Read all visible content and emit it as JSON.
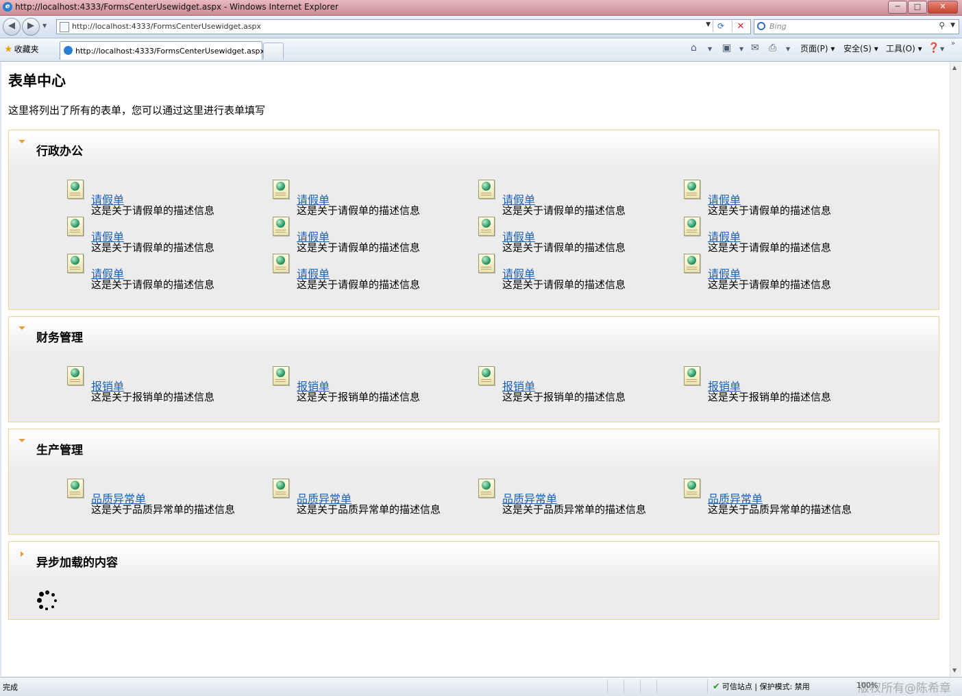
{
  "window": {
    "title": "http://localhost:4333/FormsCenterUsewidget.aspx - Windows Internet Explorer",
    "minimize": "─",
    "maximize": "□",
    "close": "✕"
  },
  "address_bar": {
    "url": "http://localhost:4333/FormsCenterUsewidget.aspx",
    "search_placeholder": "Bing"
  },
  "favorites": {
    "label": "收藏夹",
    "tab_title": "http://localhost:4333/FormsCenterUsewidget.aspx"
  },
  "command_bar": {
    "page": "页面(P) ▾",
    "safety": "安全(S) ▾",
    "tools": "工具(O) ▾"
  },
  "page": {
    "title": "表单中心",
    "intro": "这里将列出了所有的表单，您可以通过这里进行表单填写"
  },
  "sections": [
    {
      "title": "行政办公",
      "expanded": true,
      "forms": [
        {
          "name": "请假单",
          "desc": "这是关于请假单的描述信息"
        },
        {
          "name": "请假单",
          "desc": "这是关于请假单的描述信息"
        },
        {
          "name": "请假单",
          "desc": "这是关于请假单的描述信息"
        },
        {
          "name": "请假单",
          "desc": "这是关于请假单的描述信息"
        },
        {
          "name": "请假单",
          "desc": "这是关于请假单的描述信息"
        },
        {
          "name": "请假单",
          "desc": "这是关于请假单的描述信息"
        },
        {
          "name": "请假单",
          "desc": "这是关于请假单的描述信息"
        },
        {
          "name": "请假单",
          "desc": "这是关于请假单的描述信息"
        },
        {
          "name": "请假单",
          "desc": "这是关于请假单的描述信息"
        },
        {
          "name": "请假单",
          "desc": "这是关于请假单的描述信息"
        },
        {
          "name": "请假单",
          "desc": "这是关于请假单的描述信息"
        },
        {
          "name": "请假单",
          "desc": "这是关于请假单的描述信息"
        }
      ]
    },
    {
      "title": "财务管理",
      "expanded": true,
      "forms": [
        {
          "name": "报销单",
          "desc": "这是关于报销单的描述信息"
        },
        {
          "name": "报销单",
          "desc": "这是关于报销单的描述信息"
        },
        {
          "name": "报销单",
          "desc": "这是关于报销单的描述信息"
        },
        {
          "name": "报销单",
          "desc": "这是关于报销单的描述信息"
        }
      ]
    },
    {
      "title": "生产管理",
      "expanded": true,
      "forms": [
        {
          "name": "品质异常单",
          "desc": "这是关于品质异常单的描述信息"
        },
        {
          "name": "品质异常单",
          "desc": "这是关于品质异常单的描述信息"
        },
        {
          "name": "品质异常单",
          "desc": "这是关于品质异常单的描述信息"
        },
        {
          "name": "品质异常单",
          "desc": "这是关于品质异常单的描述信息"
        }
      ]
    },
    {
      "title": "异步加载的内容",
      "expanded": false,
      "loading": true
    }
  ],
  "status": {
    "text": "完成",
    "zone": "可信站点 | 保护模式: 禁用",
    "zoom": "100%"
  },
  "watermark": "版权所有@陈希章",
  "colors": {
    "link": "#1a5fb4",
    "panel_border": "#f0d890",
    "panel_bg": "#ececec",
    "arrow": "#e0a040"
  }
}
